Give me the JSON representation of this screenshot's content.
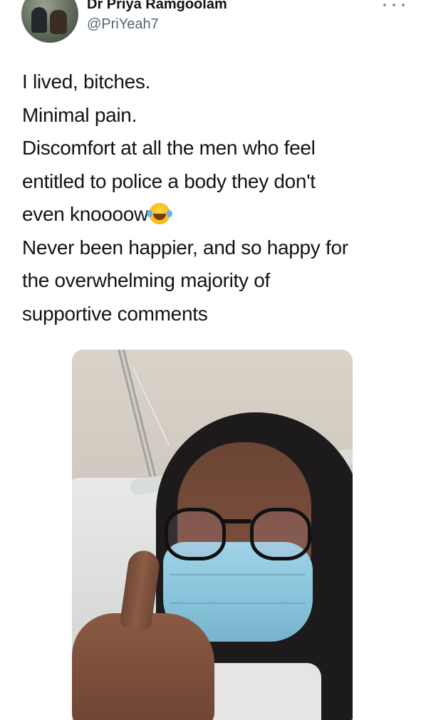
{
  "user": {
    "display_name": "Dr Priya Ramgoolam",
    "handle": "@PriYeah7"
  },
  "tweet": {
    "lines": [
      "I lived, bitches.",
      "Minimal pain.",
      "Discomfort at all the men who feel",
      "entitled to police a body they don't",
      "even knoooow",
      "Never been happier, and so happy for",
      "the overwhelming majority of",
      "supportive comments"
    ],
    "emoji_name": "face-with-tears-of-joy"
  },
  "icons": {
    "more": "more-dots-icon"
  }
}
